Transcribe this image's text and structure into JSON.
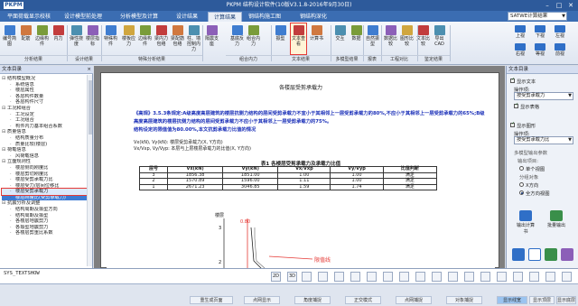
{
  "window": {
    "logo": "PKPM",
    "title": "PKPM 结构设计软件(10版V3.1.8-2016年9月30日)"
  },
  "tabs": [
    "平面荷载显示校核",
    "设计模型前处理",
    "分析模型及计算",
    "设计结果",
    "计算结果",
    "钢结构施工图",
    "钢结构深化"
  ],
  "active_tab": 4,
  "version_selector": "SATWE计算结果",
  "ribbon": {
    "buttons": [
      {
        "label": "编号简图",
        "color": "#3f7dd0"
      },
      {
        "label": "配筋",
        "color": "#d0783f"
      },
      {
        "label": "边缘构件",
        "color": "#7a9c3a"
      },
      {
        "label": "内力",
        "color": "#c23d3d"
      },
      {
        "label": "弹性挠度",
        "color": "#4c8fb0"
      },
      {
        "label": "楼层指标",
        "color": "#8c5fb8"
      },
      {
        "label": "特殊构件",
        "color": "#3f7dd0"
      },
      {
        "label": "楼板应力",
        "color": "#d0a63f"
      },
      {
        "label": "边缘构件",
        "color": "#7a9c3a"
      },
      {
        "label": "梁内力包络",
        "color": "#c23d3d"
      },
      {
        "label": "梁配筋包络",
        "color": "#d0783f"
      },
      {
        "label": "柱、墙控制内力",
        "color": "#4c8fb0"
      },
      {
        "label": "隔震支座",
        "color": "#8c5fb8"
      },
      {
        "label": "基底反力",
        "color": "#3f7dd0"
      },
      {
        "label": "组合内力",
        "color": "#7a9c3a"
      },
      {
        "label": "振型",
        "color": "#3f7dd0"
      },
      {
        "label": "文本查看",
        "color": "#c23d3d"
      },
      {
        "label": "计算书",
        "color": "#d0783f"
      },
      {
        "label": "交互",
        "color": "#4c8fb0"
      },
      {
        "label": "数据",
        "color": "#7a9c3a"
      },
      {
        "label": "自然振型",
        "color": "#3f7dd0"
      },
      {
        "label": "数据比较",
        "color": "#8c5fb8"
      },
      {
        "label": "图形比较",
        "color": "#d0a63f"
      },
      {
        "label": "文本比较",
        "color": "#c23d3d"
      },
      {
        "label": "导出CAD",
        "color": "#4c8fb0"
      }
    ],
    "groups": [
      "分析结果",
      "设计结果",
      "特殊分析结果",
      "组合内力",
      "文本结果",
      "多模型结果",
      "报表",
      "工程对比",
      "鉴定结果"
    ],
    "views": [
      "上视",
      "下视",
      "左视",
      "右视",
      "等视",
      "前视"
    ]
  },
  "left_panel": {
    "title": "文本目录",
    "items": [
      {
        "label": "结构模型概况",
        "level": 0
      },
      {
        "label": "系统信息",
        "level": 1
      },
      {
        "label": "楼层属性",
        "level": 1
      },
      {
        "label": "各层构件数量",
        "level": 1
      },
      {
        "label": "各层构件尺寸",
        "level": 1
      },
      {
        "label": "工况和组合",
        "level": 0
      },
      {
        "label": "工况设定",
        "level": 1
      },
      {
        "label": "工况组合",
        "level": 1
      },
      {
        "label": "构件内力基本组合系数",
        "level": 1
      },
      {
        "label": "质量信息",
        "level": 0
      },
      {
        "label": "结构质量分布",
        "level": 1
      },
      {
        "label": "质量比较(楼层)",
        "level": 1
      },
      {
        "label": "荷载信息",
        "level": 0
      },
      {
        "label": "风荷载信息",
        "level": 1
      },
      {
        "label": "立面规则性",
        "level": 0
      },
      {
        "label": "楼层侧向刚度比",
        "level": 1
      },
      {
        "label": "楼层剪切刚度比",
        "level": 1
      },
      {
        "label": "楼层受剪承载力比",
        "level": 1
      },
      {
        "label": "楼层受力/层间位移比",
        "level": 1
      },
      {
        "label": "楼层受剪承载力",
        "level": 1,
        "selected": true
      },
      {
        "label": "楼层刚度比(受剪承载力)",
        "level": 1,
        "highlight": true
      },
      {
        "label": "抗震分析及调整",
        "level": 0
      },
      {
        "label": "结构周期及振型方向",
        "level": 1
      },
      {
        "label": "结构周期及振型",
        "level": 1
      },
      {
        "label": "各楼层地震剪力",
        "level": 1
      },
      {
        "label": "各振型地震剪力",
        "level": 1
      },
      {
        "label": "各楼层剪重比系数",
        "level": 1
      }
    ]
  },
  "document": {
    "title": "各楼层受剪承载力",
    "note": "《高规》3.5.3条规定:A级高度高层建筑的楼层抗侧力结构的层间受剪承载力不宜小于其相邻上一层受剪承载力的80%,不应小于其相邻上一层受剪承载力的65%;B级高度高层建筑的楼层抗侧力结构的层间受剪承载力不应小于其相邻上一层受剪承载力的75%。",
    "note2": "结构设定的限值值为80.00%,本文抗剪承载力比值的情况",
    "def1": "Vx(kN), Vy(kN): 楼层受剪承载力(X, Y方向)",
    "def2": "Vx/Vxp, Vy/Vyp: 本层与上层楼层承载力的比值(X, Y方向)",
    "table_title": "表1 各楼层受剪承载力及承载力比值",
    "columns": [
      "层号",
      "Vx(kN)",
      "Vy(kN)",
      "Vx/Vxp",
      "Vy/Vyp",
      "比值判断"
    ],
    "rows": [
      [
        "3",
        "1856.38",
        "1851.00",
        "1.00",
        "1.00",
        "满足"
      ],
      [
        "2",
        "1570.89",
        "1596.00",
        "1.11",
        "1.00",
        "满足"
      ],
      [
        "1",
        "2671.23",
        "3046.85",
        "1.59",
        "1.74",
        "满足"
      ]
    ],
    "chart_axis_label": "楼层",
    "chart_tick_top": "3",
    "chart_tick_mid": "2",
    "chart_value_label": "0.80",
    "annotation": "限值线"
  },
  "right_panel": {
    "title": "文本目录",
    "show_text": "显示文本",
    "show_text_on": true,
    "op_label": "操作项:",
    "op_value": "按受剪承载力",
    "show_table": "显示表格",
    "show_table_on": true,
    "show_graph": "显示图形",
    "show_graph_on": true,
    "graph_op_label": "操作项:",
    "graph_op_value": "按受剪承载力比",
    "multi_title": "多模型输出参数",
    "multi_option": "输出项目:",
    "single_view": "单个视图",
    "multi_view": "多个视图",
    "bars_direction": "分组对象",
    "x_dir": "X方向",
    "y_dir": "全方向视图",
    "buttons": [
      {
        "label": "输出计算书",
        "color": "#2f6fc7"
      },
      {
        "label": "批量输出",
        "color": "#3a8f4a"
      }
    ]
  },
  "command": {
    "text": "SYS_TEXTSHOW"
  },
  "status": {
    "coord": "",
    "buttons": [
      "重生成页面",
      "点网显示",
      "角度捕捉",
      "正交模式",
      "点网捕捉",
      "对象捕捉",
      "显示线宽",
      "显示顶层",
      "显示底层"
    ],
    "active": 6
  }
}
